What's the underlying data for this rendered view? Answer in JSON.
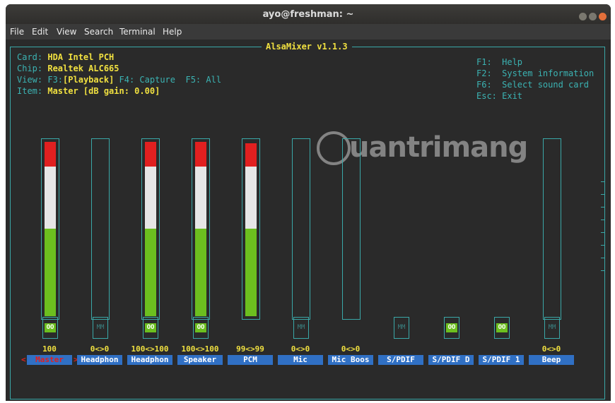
{
  "window": {
    "title": "ayo@freshman: ~"
  },
  "menu": [
    "File",
    "Edit",
    "View",
    "Search",
    "Terminal",
    "Help"
  ],
  "app": {
    "title": "AlsaMixer v1.1.3",
    "card_label": "Card:",
    "card_value": "HDA Intel PCH",
    "chip_label": "Chip:",
    "chip_value": "Realtek ALC665",
    "view_label": "View:",
    "view_f3": "F3:",
    "view_playback": "[Playback]",
    "view_f4": "F4: Capture",
    "view_f5": "F5: All",
    "item_label": "Item:",
    "item_value": "Master [dB gain: 0.00]",
    "keys": [
      "F1:  Help",
      "F2:  System information",
      "F6:  Select sound card",
      "Esc: Exit"
    ]
  },
  "controls": [
    {
      "name": "Master",
      "volume": "100",
      "mute": "OO",
      "level": 1.0,
      "has_slider": true
    },
    {
      "name": "Headphon",
      "volume": "0<>0",
      "mute": "MM",
      "level": 0.0,
      "has_slider": true
    },
    {
      "name": "Headphon",
      "volume": "100<>100",
      "mute": "OO",
      "level": 1.0,
      "has_slider": true
    },
    {
      "name": "Speaker",
      "volume": "100<>100",
      "mute": "OO",
      "level": 1.0,
      "has_slider": true
    },
    {
      "name": "PCM",
      "volume": "99<>99",
      "mute": "",
      "level": 0.99,
      "has_slider": true
    },
    {
      "name": "Mic",
      "volume": "0<>0",
      "mute": "MM",
      "level": 0.0,
      "has_slider": true
    },
    {
      "name": "Mic Boos",
      "volume": "0<>0",
      "mute": "",
      "level": 0.0,
      "has_slider": true
    },
    {
      "name": "S/PDIF",
      "volume": "",
      "mute": "MM",
      "level": 0.0,
      "has_slider": false
    },
    {
      "name": "S/PDIF D",
      "volume": "",
      "mute": "OO",
      "level": 0.0,
      "has_slider": false
    },
    {
      "name": "S/PDIF 1",
      "volume": "",
      "mute": "OO",
      "level": 0.0,
      "has_slider": false
    },
    {
      "name": "Beep",
      "volume": "0<>0",
      "mute": "MM",
      "level": 0.0,
      "has_slider": true
    }
  ],
  "selected_arrow_left": "<",
  "selected_arrow_right": ">",
  "watermark": "uantrimang",
  "colors": {
    "accent": "#3aa8a8",
    "highlight": "#f0e040",
    "red": "#e02020",
    "green": "#6cbf1f",
    "blue": "#3070c4"
  }
}
